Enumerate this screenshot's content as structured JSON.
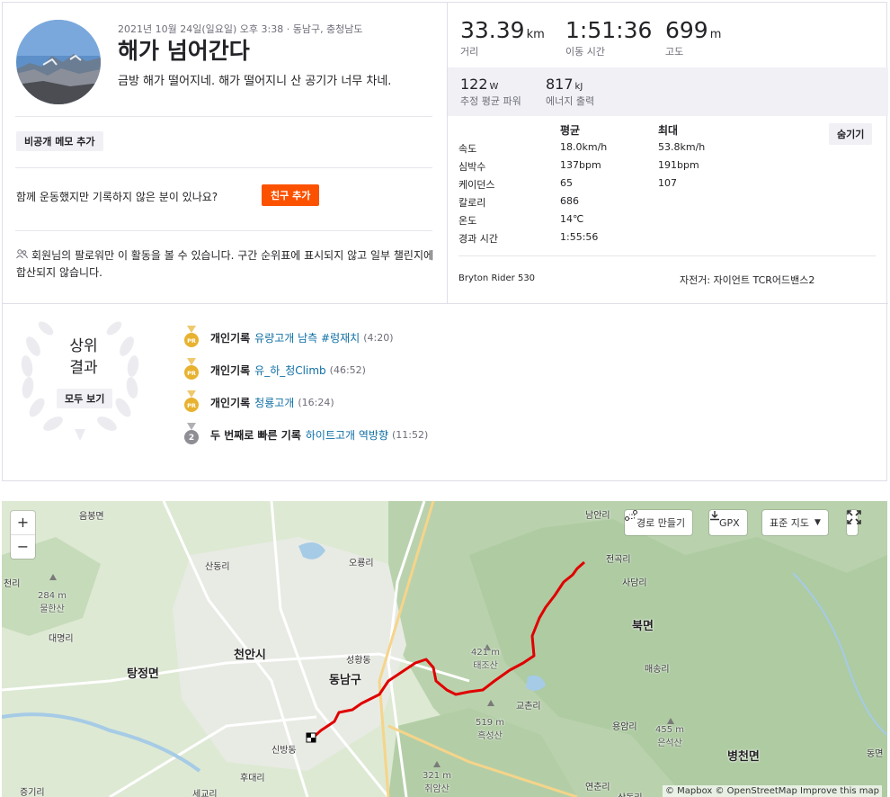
{
  "activity": {
    "meta": "2021년 10월 24일(일요일) 오후 3:38 · 동남구, 충청남도",
    "title": "해가 넘어간다",
    "description": "금방 해가 떨어지네. 해가 떨어지니 산 공기가 너무 차네.",
    "private_note_btn": "비공개 메모 추가",
    "together_text": "함께 운동했지만 기록하지 않은 분이 있나요?",
    "add_friend_btn": "친구 추가",
    "privacy_text": "회원님의 팔로워만 이 활동을 볼 수 있습니다. 구간 순위표에 표시되지 않고 일부 챌린지에 합산되지 않습니다."
  },
  "stats": {
    "distance": {
      "value": "33.39",
      "unit": "km",
      "label": "거리"
    },
    "moving_time": {
      "value": "1:51:36",
      "label": "이동 시간"
    },
    "elevation": {
      "value": "699",
      "unit": "m",
      "label": "고도"
    },
    "power": {
      "value": "122",
      "unit": "W",
      "label": "추정 평균 파워"
    },
    "energy": {
      "value": "817",
      "unit": "kJ",
      "label": "에너지 출력"
    }
  },
  "table": {
    "col_avg": "평균",
    "col_max": "최대",
    "hide_btn": "숨기기",
    "rows": [
      {
        "label": "속도",
        "avg": "18.0km/h",
        "max": "53.8km/h"
      },
      {
        "label": "심박수",
        "avg": "137bpm",
        "max": "191bpm"
      },
      {
        "label": "케이던스",
        "avg": "65",
        "max": "107"
      },
      {
        "label": "칼로리",
        "avg": "686",
        "max": ""
      },
      {
        "label": "온도",
        "avg": "14℃",
        "max": ""
      },
      {
        "label": "경과 시간",
        "avg": "1:55:56",
        "max": ""
      }
    ],
    "device": "Bryton Rider 530",
    "bike": "자전거: 자이언트 TCR어드밴스2"
  },
  "results": {
    "title_line1": "상위",
    "title_line2": "결과",
    "view_all_btn": "모두 보기",
    "items": [
      {
        "type": "개인기록",
        "segment": "유량고개 남측 #렁재치",
        "time": "(4:20)",
        "medal": "gold",
        "badge": "PR"
      },
      {
        "type": "개인기록",
        "segment": "유_하_청Climb",
        "time": "(46:52)",
        "medal": "gold",
        "badge": "PR"
      },
      {
        "type": "개인기록",
        "segment": "청룡고개",
        "time": "(16:24)",
        "medal": "gold",
        "badge": "PR"
      },
      {
        "type": "두 번째로 빠른 기록",
        "segment": "하이트고개 역방향",
        "time": "(11:52)",
        "medal": "silver",
        "badge": "2"
      }
    ]
  },
  "map": {
    "zoom_in": "+",
    "zoom_out": "−",
    "route_builder": "경로 만들기",
    "gpx": "GPX",
    "map_type": "표준 지도",
    "attribution": "© Mapbox © OpenStreetMap Improve this map",
    "labels": {
      "eumbong": "음봉면",
      "sandong": "산동리",
      "daemyeong": "대명리",
      "oreuk": "오룡리",
      "cheonan": "천안시",
      "tangjeong": "탕정면",
      "dongnam": "동남구",
      "seongdong": "성황동",
      "cheonguk": "전곡리",
      "sadang": "사담리",
      "bukmyeon": "북면",
      "maesong": "매송리",
      "byeongcheon": "병천면",
      "dongmyeon": "동면",
      "gyochon": "교촌리",
      "yongam": "용암리",
      "namanri": "남안리",
      "sinbang": "신방동",
      "hudae": "후대리",
      "segyo": "세교리",
      "jeunggi": "증기리",
      "yeonchun": "연춘리",
      "sangdong": "상동리",
      "cheonri": "천리",
      "peak1_h": "284 m",
      "peak1_n": "물한산",
      "peak2_h": "421 m",
      "peak2_n": "태조산",
      "peak3_h": "519 m",
      "peak3_n": "흑성산",
      "peak4_h": "455 m",
      "peak4_n": "은석산",
      "peak5_h": "321 m",
      "peak5_n": "취암산"
    }
  }
}
